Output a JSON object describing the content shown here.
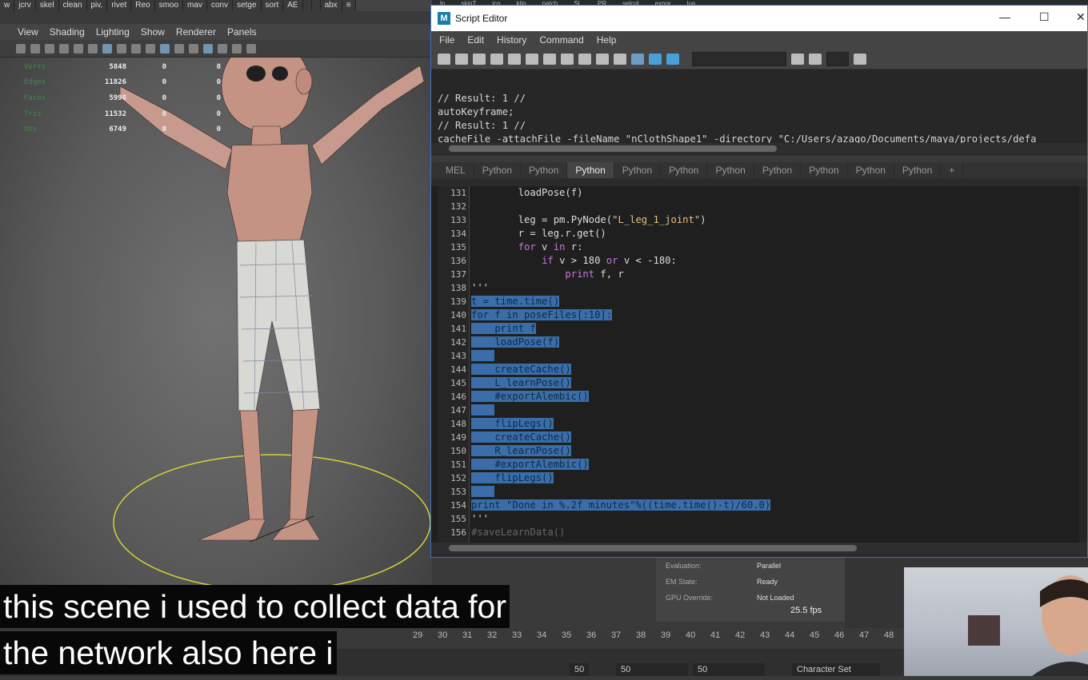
{
  "maya": {
    "shelf_tabs": [
      "w",
      "jcrv",
      "skel",
      "clean",
      "piv,",
      "rivet",
      "Reo",
      "smoo",
      "mav",
      "conv",
      "setge",
      "sort",
      "AE",
      "",
      "",
      "abx",
      "≡"
    ],
    "top_right_tabs": [
      "ln",
      "skinT",
      "ico",
      "klip",
      "patch",
      "SL",
      "PR",
      "selcol",
      "expor",
      "lua"
    ],
    "panel_menu": [
      "View",
      "Shading",
      "Lighting",
      "Show",
      "Renderer",
      "Panels"
    ],
    "hud": [
      {
        "label": "Verts",
        "a": "5848",
        "b": "0",
        "c": "0"
      },
      {
        "label": "Edges",
        "a": "11826",
        "b": "0",
        "c": "0"
      },
      {
        "label": "Faces",
        "a": "5998",
        "b": "0",
        "c": "0"
      },
      {
        "label": "Tris",
        "a": "11532",
        "b": "0",
        "c": "0"
      },
      {
        "label": "UVs",
        "a": "6749",
        "b": "0",
        "c": "0"
      }
    ],
    "info": [
      {
        "k": "Evaluation:",
        "v": "Parallel"
      },
      {
        "k": "EM State:",
        "v": "Ready"
      },
      {
        "k": "GPU Override:",
        "v": "Not Loaded"
      }
    ],
    "fps": "25.5 fps",
    "timeline_ticks": [
      "29",
      "30",
      "31",
      "32",
      "33",
      "34",
      "35",
      "36",
      "37",
      "38",
      "39",
      "40",
      "41",
      "42",
      "43",
      "44",
      "45",
      "46",
      "47",
      "48"
    ],
    "range_fields": [
      "50",
      "50",
      "50"
    ],
    "character_set": "Character Set"
  },
  "script_editor": {
    "title": "Script Editor",
    "menu": [
      "File",
      "Edit",
      "History",
      "Command",
      "Help"
    ],
    "history": [
      "// Result: 1 //",
      "autoKeyframe;",
      "// Result: 1 //",
      "cacheFile -attachFile -fileName \"nClothShape1\" -directory \"C:/Users/azago/Documents/maya/projects/defa",
      "// Result: nClothShape1Cache1 //"
    ],
    "tabs": [
      "MEL",
      "Python",
      "Python",
      "Python",
      "Python",
      "Python",
      "Python",
      "Python",
      "Python",
      "Python",
      "Python",
      "+"
    ],
    "active_tab": 3,
    "lines": [
      {
        "n": "131",
        "t": "        loadPose(f)",
        "h": false
      },
      {
        "n": "132",
        "t": "",
        "h": false
      },
      {
        "n": "133",
        "t": "        leg = pm.PyNode(\"L_leg_1_joint\")",
        "h": false
      },
      {
        "n": "134",
        "t": "        r = leg.r.get()",
        "h": false
      },
      {
        "n": "135",
        "t": "        for v in r:",
        "h": false
      },
      {
        "n": "136",
        "t": "            if v > 180 or v < -180:",
        "h": false
      },
      {
        "n": "137",
        "t": "                print f, r",
        "h": false
      },
      {
        "n": "138",
        "t": "'''",
        "h": false
      },
      {
        "n": "139",
        "t": "t = time.time()",
        "h": true
      },
      {
        "n": "140",
        "t": "for f in poseFiles[:10]:",
        "h": true
      },
      {
        "n": "141",
        "t": "    print f",
        "h": true
      },
      {
        "n": "142",
        "t": "    loadPose(f)",
        "h": true
      },
      {
        "n": "143",
        "t": "    ",
        "h": true
      },
      {
        "n": "144",
        "t": "    createCache()",
        "h": true
      },
      {
        "n": "145",
        "t": "    L_learnPose()",
        "h": true
      },
      {
        "n": "146",
        "t": "    #exportAlembic()",
        "h": true
      },
      {
        "n": "147",
        "t": "    ",
        "h": true
      },
      {
        "n": "148",
        "t": "    flipLegs()",
        "h": true
      },
      {
        "n": "149",
        "t": "    createCache()",
        "h": true
      },
      {
        "n": "150",
        "t": "    R_learnPose()",
        "h": true
      },
      {
        "n": "151",
        "t": "    #exportAlembic()",
        "h": true
      },
      {
        "n": "152",
        "t": "    flipLegs()",
        "h": true
      },
      {
        "n": "153",
        "t": "    ",
        "h": true
      },
      {
        "n": "154",
        "t": "print \"Done in %.2f minutes\"%((time.time()-t)/60.0)",
        "h": true
      },
      {
        "n": "155",
        "t": "'''",
        "h": false
      },
      {
        "n": "156",
        "t": "#saveLearnData()",
        "h": false
      }
    ]
  },
  "captions": [
    "this scene i used to collect data for",
    "the network also here i"
  ],
  "colors": {
    "accent": "#3b72c8",
    "selection": "#3b6ea8",
    "keyword": "#c678dd",
    "string": "#e5c07b",
    "hud_label": "#3c8c46"
  }
}
